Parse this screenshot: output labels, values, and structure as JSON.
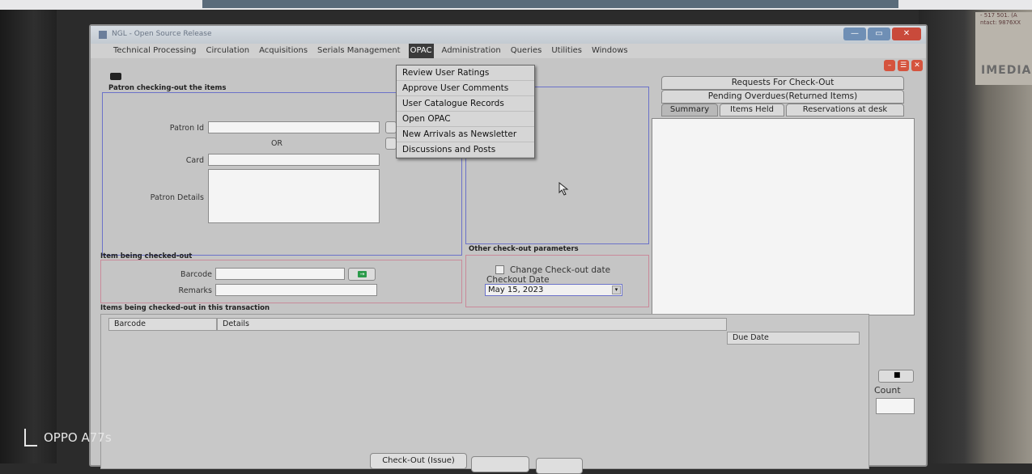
{
  "window": {
    "title": "NGL - Open Source Release"
  },
  "menu": {
    "items": [
      "Technical Processing",
      "Circulation",
      "Acquisitions",
      "Serials Management",
      "OPAC",
      "Administration",
      "Queries",
      "Utilities",
      "Windows"
    ],
    "active": "OPAC"
  },
  "opac_menu": [
    "Review User Ratings",
    "Approve User Comments",
    "User Catalogue Records",
    "Open OPAC",
    "New Arrivals as Newsletter",
    "Discussions and Posts"
  ],
  "patron": {
    "group_title": "Patron checking-out the items",
    "patron_id_label": "Patron Id",
    "or_label": "OR",
    "card_label": "Card",
    "details_label": "Patron Details"
  },
  "item": {
    "group_title": "Item being checked-out",
    "barcode_label": "Barcode",
    "remarks_label": "Remarks"
  },
  "other": {
    "group_title": "Other check-out parameters",
    "change_date_label": "Change Check-out date",
    "checkout_date_label": "Checkout Date",
    "checkout_date_value": "May 15, 2023"
  },
  "right_tabs": {
    "requests": "Requests For Check-Out",
    "pending": "Pending Overdues(Returned Items)",
    "summary": "Summary",
    "items_held": "Items Held",
    "reservations": "Reservations at desk"
  },
  "transaction": {
    "group_title": "Items being checked-out in this transaction",
    "columns": [
      "Barcode",
      "Details",
      "Due Date"
    ],
    "count_label": "Count"
  },
  "buttons": {
    "checkout": "Check-Out (Issue)"
  },
  "photo": {
    "watermark": "OPPO A77s",
    "wall_brand": "IMEDIA",
    "wall_lines": [
      "- 517 501. (A",
      "ntact: 9876XX",
      "",
      ""
    ]
  },
  "colors": {
    "menu_active_bg": "#3b3b3b",
    "panel_blue": "#6b72c9",
    "panel_red": "#c98a9a",
    "close_red": "#c94a3b"
  }
}
